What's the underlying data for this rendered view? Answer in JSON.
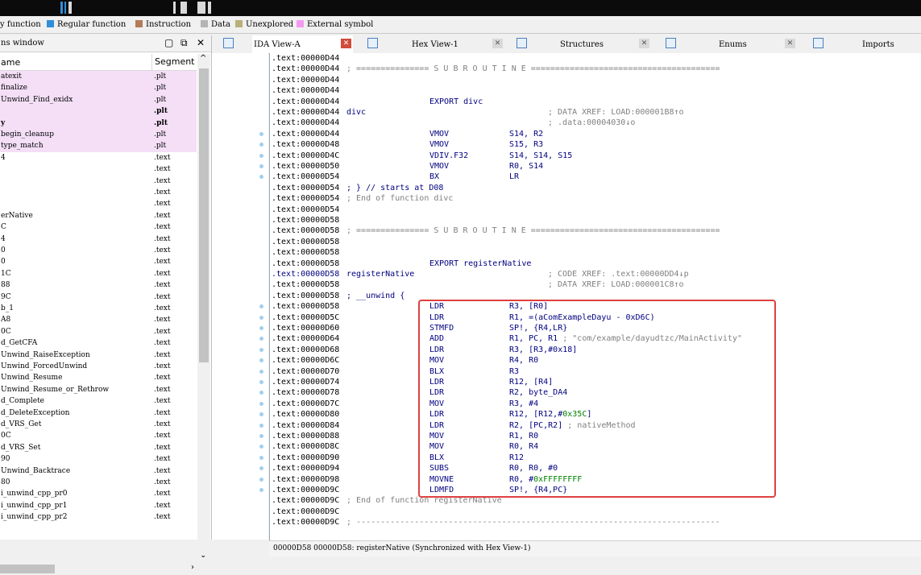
{
  "legend": [
    {
      "label": "y function",
      "color": "#9cc4e6"
    },
    {
      "label": "Regular function",
      "color": "#2f8fd8"
    },
    {
      "label": "Instruction",
      "color": "#b47a5a"
    },
    {
      "label": "Data",
      "color": "#b4b4b4"
    },
    {
      "label": "Unexplored",
      "color": "#b8b07a"
    },
    {
      "label": "External symbol",
      "color": "#f39af0"
    }
  ],
  "functions_window": {
    "title": "ns window",
    "col_name": "ame",
    "col_segment": "Segment",
    "rows": [
      {
        "name": "atexit",
        "segment": ".plt",
        "pink": true
      },
      {
        "name": "finalize",
        "segment": ".plt",
        "pink": true
      },
      {
        "name": "Unwind_Find_exidx",
        "segment": ".plt",
        "pink": true
      },
      {
        "name": "",
        "segment": ".plt",
        "pink": true,
        "bold": true
      },
      {
        "name": "y",
        "segment": ".plt",
        "pink": true,
        "bold": true
      },
      {
        "name": "begin_cleanup",
        "segment": ".plt",
        "pink": true
      },
      {
        "name": "type_match",
        "segment": ".plt",
        "pink": true
      },
      {
        "name": "4",
        "segment": ".text"
      },
      {
        "name": "",
        "segment": ".text"
      },
      {
        "name": "",
        "segment": ".text"
      },
      {
        "name": "",
        "segment": ".text"
      },
      {
        "name": "",
        "segment": ".text"
      },
      {
        "name": "erNative",
        "segment": ".text"
      },
      {
        "name": "C",
        "segment": ".text"
      },
      {
        "name": "4",
        "segment": ".text"
      },
      {
        "name": "0",
        "segment": ".text"
      },
      {
        "name": "0",
        "segment": ".text"
      },
      {
        "name": "1C",
        "segment": ".text"
      },
      {
        "name": "88",
        "segment": ".text"
      },
      {
        "name": "9C",
        "segment": ".text"
      },
      {
        "name": "b_1",
        "segment": ".text"
      },
      {
        "name": "A8",
        "segment": ".text"
      },
      {
        "name": "0C",
        "segment": ".text"
      },
      {
        "name": "d_GetCFA",
        "segment": ".text"
      },
      {
        "name": "Unwind_RaiseException",
        "segment": ".text"
      },
      {
        "name": "Unwind_ForcedUnwind",
        "segment": ".text"
      },
      {
        "name": "Unwind_Resume",
        "segment": ".text"
      },
      {
        "name": "Unwind_Resume_or_Rethrow",
        "segment": ".text"
      },
      {
        "name": "d_Complete",
        "segment": ".text"
      },
      {
        "name": "d_DeleteException",
        "segment": ".text"
      },
      {
        "name": "d_VRS_Get",
        "segment": ".text"
      },
      {
        "name": "0C",
        "segment": ".text"
      },
      {
        "name": "d_VRS_Set",
        "segment": ".text"
      },
      {
        "name": "90",
        "segment": ".text"
      },
      {
        "name": "Unwind_Backtrace",
        "segment": ".text"
      },
      {
        "name": "80",
        "segment": ".text"
      },
      {
        "name": "i_unwind_cpp_pr0",
        "segment": ".text"
      },
      {
        "name": "i_unwind_cpp_pr1",
        "segment": ".text"
      },
      {
        "name": "i_unwind_cpp_pr2",
        "segment": ".text"
      }
    ]
  },
  "tabs": [
    {
      "label": "IDA View-A",
      "active": true
    },
    {
      "label": "Hex View-1"
    },
    {
      "label": "Structures"
    },
    {
      "label": "Enums"
    },
    {
      "label": "Imports"
    }
  ],
  "disasm": [
    {
      "addr": ".text:00000D44"
    },
    {
      "addr": ".text:00000D44",
      "comment": "; =============== S U B R O U T I N E ======================================="
    },
    {
      "addr": ".text:00000D44"
    },
    {
      "addr": ".text:00000D44"
    },
    {
      "addr": ".text:00000D44",
      "mnem": "EXPORT divc"
    },
    {
      "addr": ".text:00000D44",
      "label": "divc",
      "xref": "; DATA XREF: LOAD:000001B8↑o"
    },
    {
      "addr": ".text:00000D44",
      "xref": "; .data:00004030↓o"
    },
    {
      "addr": ".text:00000D44",
      "mnem": "VMOV",
      "ops": "S14, R2"
    },
    {
      "addr": ".text:00000D48",
      "mnem": "VMOV",
      "ops": "S15, R3"
    },
    {
      "addr": ".text:00000D4C",
      "mnem": "VDIV.F32",
      "ops": "S14, S14, S15"
    },
    {
      "addr": ".text:00000D50",
      "mnem": "VMOV",
      "ops": "R0, S14"
    },
    {
      "addr": ".text:00000D54",
      "mnem": "BX",
      "ops": "LR"
    },
    {
      "addr": ".text:00000D54",
      "label": "; } // starts at D08"
    },
    {
      "addr": ".text:00000D54",
      "comment": "; End of function divc"
    },
    {
      "addr": ".text:00000D54"
    },
    {
      "addr": ".text:00000D58"
    },
    {
      "addr": ".text:00000D58",
      "comment": "; =============== S U B R O U T I N E ======================================="
    },
    {
      "addr": ".text:00000D58"
    },
    {
      "addr": ".text:00000D58"
    },
    {
      "addr": ".text:00000D58",
      "mnem": "EXPORT registerNative"
    },
    {
      "addr": ".text:00000D58",
      "label": "registerNative",
      "xref": "; CODE XREF: .text:00000DD4↓p",
      "blue_addr": true
    },
    {
      "addr": ".text:00000D58",
      "xref": "; DATA XREF: LOAD:000001C8↑o"
    },
    {
      "addr": ".text:00000D58",
      "label": "; __unwind {"
    },
    {
      "addr": ".text:00000D58",
      "mnem": "LDR",
      "ops": "R3, [R0]"
    },
    {
      "addr": ".text:00000D5C",
      "mnem": "LDR",
      "ops": "R1, =(aComExampleDayu - 0xD6C)"
    },
    {
      "addr": ".text:00000D60",
      "mnem": "STMFD",
      "ops": "SP!, {R4,LR}"
    },
    {
      "addr": ".text:00000D64",
      "mnem": "ADD",
      "ops": "R1, PC, R1",
      "opcomment": " ; \"com/example/dayudtzc/MainActivity\""
    },
    {
      "addr": ".text:00000D68",
      "mnem": "LDR",
      "ops": "R3, [R3,#0x18]"
    },
    {
      "addr": ".text:00000D6C",
      "mnem": "MOV",
      "ops": "R4, R0"
    },
    {
      "addr": ".text:00000D70",
      "mnem": "BLX",
      "ops": "R3"
    },
    {
      "addr": ".text:00000D74",
      "mnem": "LDR",
      "ops": "R12, [R4]"
    },
    {
      "addr": ".text:00000D78",
      "mnem": "LDR",
      "ops": "R2, byte_DA4"
    },
    {
      "addr": ".text:00000D7C",
      "mnem": "MOV",
      "ops": "R3, #4"
    },
    {
      "addr": ".text:00000D80",
      "mnem": "LDR",
      "ops": "R12, [R12,#",
      "num": "0x35C",
      "ops2": "]"
    },
    {
      "addr": ".text:00000D84",
      "mnem": "LDR",
      "ops": "R2, [PC,R2]",
      "opcomment": " ; nativeMethod"
    },
    {
      "addr": ".text:00000D88",
      "mnem": "MOV",
      "ops": "R1, R0"
    },
    {
      "addr": ".text:00000D8C",
      "mnem": "MOV",
      "ops": "R0, R4"
    },
    {
      "addr": ".text:00000D90",
      "mnem": "BLX",
      "ops": "R12"
    },
    {
      "addr": ".text:00000D94",
      "mnem": "SUBS",
      "ops": "R0, R0, #0"
    },
    {
      "addr": ".text:00000D98",
      "mnem": "MOVNE",
      "ops": "R0, #",
      "num": "0xFFFFFFFF",
      "ops2": ""
    },
    {
      "addr": ".text:00000D9C",
      "mnem": "LDMFD",
      "ops": "SP!, {R4,PC}"
    },
    {
      "addr": ".text:00000D9C",
      "comment": "; End of function registerNative"
    },
    {
      "addr": ".text:00000D9C"
    },
    {
      "addr": ".text:00000D9C",
      "comment": "; ---------------------------------------------------------------------------"
    }
  ],
  "status": "00000D58 00000D58: registerNative (Synchronized with Hex View-1)"
}
